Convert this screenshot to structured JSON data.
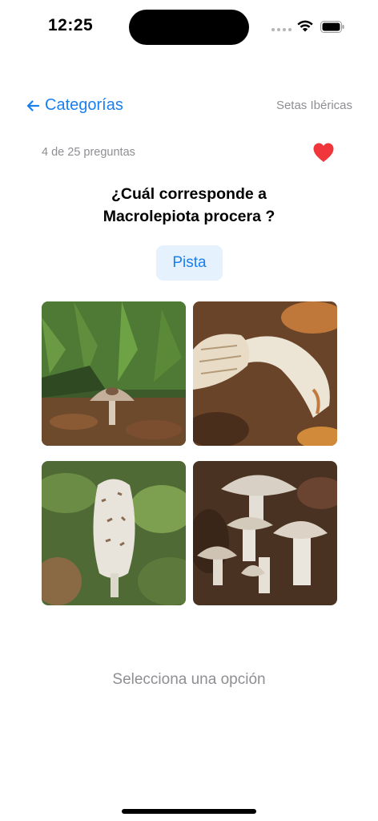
{
  "status_bar": {
    "time": "12:25",
    "icons": [
      "cellular-icon",
      "wifi-icon",
      "battery-icon"
    ]
  },
  "nav": {
    "back_label": "Categorías",
    "right_label": "Setas Ibéricas"
  },
  "quiz": {
    "progress": "4 de 25 preguntas",
    "question_line1": "¿Cuál corresponde a",
    "question_line2": "Macrolepiota procera  ?",
    "hint_label": "Pista",
    "prompt": "Selecciona una opción"
  },
  "options": [
    {
      "icon": "mushroom-photo-1"
    },
    {
      "icon": "mushroom-photo-2"
    },
    {
      "icon": "mushroom-photo-3"
    },
    {
      "icon": "mushroom-photo-4"
    }
  ],
  "colors": {
    "accent": "#1a7ff0",
    "heart": "#f0363b",
    "hint_bg": "#e5f1fd",
    "secondary_text": "#8e8e93"
  }
}
